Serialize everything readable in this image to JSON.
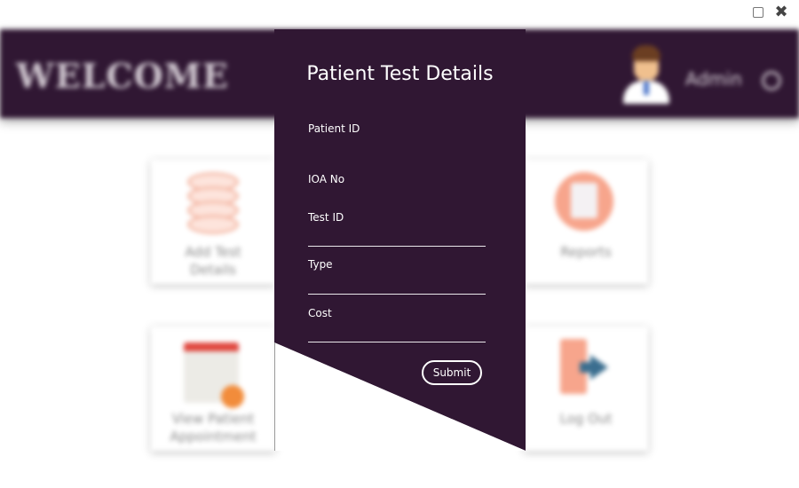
{
  "window": {
    "minimize_icon": "minimize-icon",
    "close_symbol": "✖"
  },
  "header": {
    "welcome": "WELCOME",
    "user_name": "Admin",
    "settings_icon": "gear-icon"
  },
  "cards": [
    {
      "label": "Add Test Details",
      "icon": "database-icon"
    },
    {
      "label": "Reports",
      "icon": "report-icon"
    },
    {
      "label": "View Patient Appointment",
      "icon": "calendar-icon"
    },
    {
      "label": "Log Out",
      "icon": "logout-icon"
    }
  ],
  "dialog": {
    "title": "Patient Test Details",
    "fields": {
      "patient_id": "Patient ID",
      "ioa_no": "IOA No",
      "test_id": "Test ID",
      "type": "Type",
      "cost": "Cost"
    },
    "submit_label": "Submit"
  },
  "colors": {
    "primary": "#301733",
    "accent": "#f7a58c",
    "text_on_primary": "#ffffff"
  }
}
